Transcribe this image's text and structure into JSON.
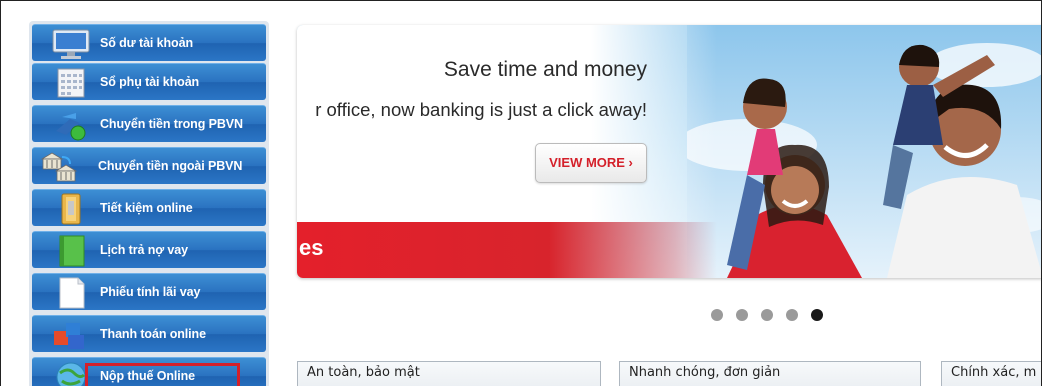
{
  "sidebar": {
    "items": [
      {
        "label": "Số dư tài khoản",
        "icon": "monitor-icon"
      },
      {
        "label": "Sổ phụ tài khoản",
        "icon": "calendar-icon"
      },
      {
        "label": "Chuyển tiền trong PBVN",
        "icon": "transfer-icon"
      },
      {
        "label": "Chuyển tiền ngoài PBVN",
        "icon": "bank-icon"
      },
      {
        "label": "Tiết kiệm online",
        "icon": "folder-icon"
      },
      {
        "label": "Lịch trả nợ vay",
        "icon": "green-book-icon"
      },
      {
        "label": "Phiếu tính lãi vay",
        "icon": "document-icon"
      },
      {
        "label": "Thanh toán online",
        "icon": "blocks-icon"
      },
      {
        "label": "Nộp thuế Online",
        "icon": "globe-icon"
      }
    ],
    "highlighted_index": 8
  },
  "banner": {
    "headline": "Save time and money",
    "subline": "r office, now banking is just a click away!",
    "button_label": "VIEW MORE  ›",
    "strip_text": "es"
  },
  "carousel": {
    "count": 5,
    "active_index": 4
  },
  "features": [
    {
      "title": "An toàn, bảo mật"
    },
    {
      "title": "Nhanh chóng, đơn giản"
    },
    {
      "title": "Chính xác, m"
    }
  ],
  "colors": {
    "menu_blue": "#2a72c0",
    "highlight_red": "#d4202a",
    "banner_red": "#e4202b"
  }
}
